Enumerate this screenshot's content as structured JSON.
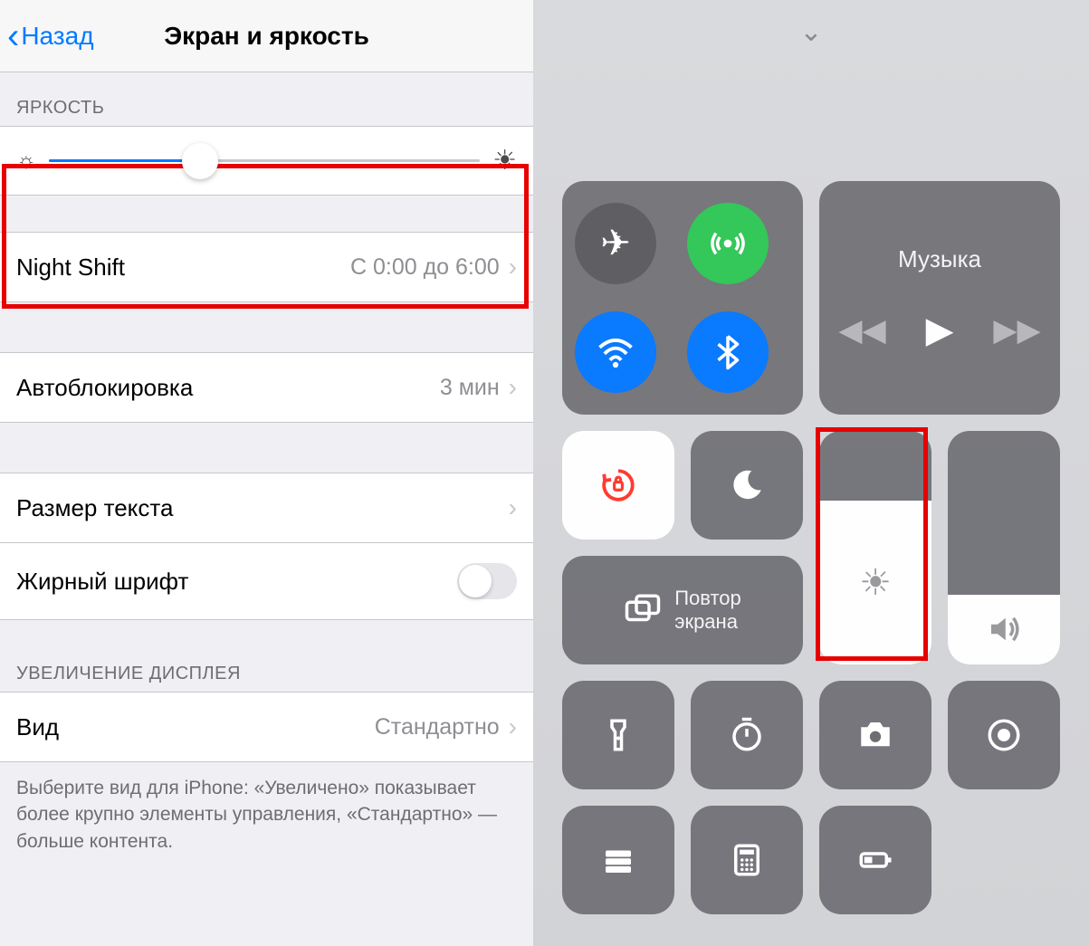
{
  "settings": {
    "back_label": "Назад",
    "title": "Экран и яркость",
    "brightness_header": "ЯРКОСТЬ",
    "brightness_value_percent": 35,
    "night_shift": {
      "label": "Night Shift",
      "value": "С 0:00 до 6:00"
    },
    "auto_lock": {
      "label": "Автоблокировка",
      "value": "3 мин"
    },
    "text_size": {
      "label": "Размер текста"
    },
    "bold_text": {
      "label": "Жирный шрифт",
      "enabled": false
    },
    "display_zoom_header": "УВЕЛИЧЕНИЕ ДИСПЛЕЯ",
    "view": {
      "label": "Вид",
      "value": "Стандартно"
    },
    "footer": "Выберите вид для iPhone: «Увеличено» показывает более крупно элементы управления, «Стандартно» — больше контента."
  },
  "control_center": {
    "music_label": "Музыка",
    "screen_mirroring_line1": "Повтор",
    "screen_mirroring_line2": "экрана",
    "brightness_level_percent": 70,
    "volume_level_percent": 30,
    "toggles": {
      "airplane": false,
      "cellular": true,
      "wifi": true,
      "bluetooth": true,
      "orientation_lock": true,
      "do_not_disturb": false
    },
    "icons": [
      "flashlight",
      "timer",
      "camera",
      "record",
      "wallet",
      "calculator",
      "low-power"
    ]
  }
}
